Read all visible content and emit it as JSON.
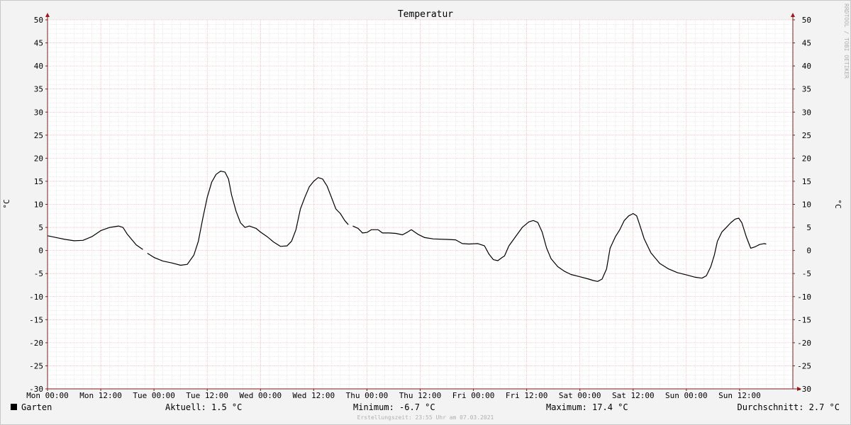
{
  "chart_data": {
    "type": "line",
    "title": "Temperatur",
    "ylabel": "°C",
    "ylabel_right": "°C",
    "watermark": "RRDTOOL / TOBI OETIKER",
    "ylim": [
      -30,
      50
    ],
    "yticks": [
      -30,
      -25,
      -20,
      -15,
      -10,
      -5,
      0,
      5,
      10,
      15,
      20,
      25,
      30,
      35,
      40,
      45,
      50
    ],
    "xlim": [
      0,
      168
    ],
    "x_unit": "hours since Mon 00:00",
    "xticks": [
      {
        "x": 0,
        "label": "Mon 00:00"
      },
      {
        "x": 12,
        "label": "Mon 12:00"
      },
      {
        "x": 24,
        "label": "Tue 00:00"
      },
      {
        "x": 36,
        "label": "Tue 12:00"
      },
      {
        "x": 48,
        "label": "Wed 00:00"
      },
      {
        "x": 60,
        "label": "Wed 12:00"
      },
      {
        "x": 72,
        "label": "Thu 00:00"
      },
      {
        "x": 84,
        "label": "Thu 12:00"
      },
      {
        "x": 96,
        "label": "Fri 00:00"
      },
      {
        "x": 108,
        "label": "Fri 12:00"
      },
      {
        "x": 120,
        "label": "Sat 00:00"
      },
      {
        "x": 132,
        "label": "Sat 12:00"
      },
      {
        "x": 144,
        "label": "Sun 00:00"
      },
      {
        "x": 156,
        "label": "Sun 12:00"
      }
    ],
    "grid": true,
    "series": [
      {
        "name": "Garten",
        "color": "#000000",
        "segments": [
          [
            [
              0,
              3.2
            ],
            [
              2,
              2.8
            ],
            [
              4,
              2.4
            ],
            [
              6,
              2.1
            ],
            [
              8,
              2.2
            ],
            [
              10,
              3.0
            ],
            [
              12,
              4.3
            ],
            [
              14,
              5.0
            ],
            [
              16,
              5.3
            ],
            [
              17,
              5.0
            ],
            [
              18,
              3.5
            ],
            [
              20,
              1.2
            ],
            [
              21.5,
              0.2
            ]
          ],
          [
            [
              22.5,
              -0.6
            ],
            [
              24,
              -1.5
            ],
            [
              26,
              -2.3
            ],
            [
              28,
              -2.7
            ],
            [
              30,
              -3.2
            ],
            [
              31.5,
              -3.0
            ],
            [
              33,
              -1.0
            ],
            [
              34,
              2.0
            ],
            [
              35,
              7.0
            ],
            [
              36,
              11.5
            ],
            [
              37,
              14.8
            ],
            [
              38,
              16.5
            ],
            [
              39,
              17.2
            ],
            [
              40,
              17.0
            ],
            [
              40.8,
              15.5
            ],
            [
              41.5,
              12.0
            ],
            [
              42.5,
              8.5
            ],
            [
              43.5,
              6.0
            ],
            [
              44.5,
              5.0
            ],
            [
              45.5,
              5.3
            ],
            [
              47,
              4.8
            ],
            [
              48,
              4.0
            ],
            [
              49.5,
              3.0
            ],
            [
              51,
              1.8
            ],
            [
              52.5,
              0.9
            ],
            [
              54,
              1.0
            ],
            [
              55,
              2.0
            ],
            [
              56,
              4.5
            ],
            [
              57,
              9.0
            ],
            [
              58,
              11.5
            ],
            [
              59,
              13.8
            ],
            [
              60,
              15.0
            ],
            [
              61,
              15.8
            ],
            [
              62,
              15.5
            ],
            [
              63,
              14.0
            ],
            [
              64,
              11.5
            ],
            [
              65,
              9.0
            ],
            [
              66,
              8.0
            ],
            [
              67,
              6.5
            ],
            [
              67.8,
              5.6
            ]
          ],
          [
            [
              68.8,
              5.3
            ],
            [
              70,
              4.8
            ],
            [
              71,
              3.8
            ],
            [
              72,
              3.9
            ],
            [
              73,
              4.5
            ],
            [
              74.5,
              4.5
            ],
            [
              75.5,
              3.8
            ],
            [
              77,
              3.8
            ],
            [
              78.5,
              3.7
            ],
            [
              80,
              3.4
            ],
            [
              81,
              3.9
            ],
            [
              82,
              4.5
            ],
            [
              83.5,
              3.5
            ],
            [
              85,
              2.8
            ],
            [
              87,
              2.5
            ],
            [
              90,
              2.4
            ],
            [
              92,
              2.3
            ],
            [
              93.5,
              1.5
            ],
            [
              95,
              1.4
            ],
            [
              97,
              1.5
            ],
            [
              98.5,
              1.0
            ],
            [
              99.5,
              -0.8
            ],
            [
              100.5,
              -2.0
            ],
            [
              101.5,
              -2.2
            ],
            [
              102.5,
              -1.5
            ],
            [
              103,
              -1.2
            ],
            [
              104,
              1.0
            ],
            [
              105.5,
              3.0
            ],
            [
              107,
              5.0
            ],
            [
              108.5,
              6.2
            ],
            [
              109.5,
              6.5
            ],
            [
              110.5,
              6.1
            ],
            [
              111.5,
              4.0
            ],
            [
              112.5,
              0.5
            ],
            [
              113.5,
              -1.8
            ],
            [
              115,
              -3.5
            ],
            [
              116.5,
              -4.5
            ],
            [
              118,
              -5.2
            ],
            [
              120,
              -5.7
            ],
            [
              122,
              -6.2
            ],
            [
              123,
              -6.5
            ],
            [
              124,
              -6.7
            ],
            [
              125,
              -6.2
            ],
            [
              126,
              -4.0
            ],
            [
              126.8,
              0.5
            ],
            [
              128,
              3.0
            ],
            [
              129,
              4.5
            ],
            [
              130,
              6.5
            ],
            [
              131,
              7.5
            ],
            [
              132,
              8.0
            ],
            [
              132.8,
              7.5
            ],
            [
              133.5,
              5.5
            ],
            [
              134.5,
              2.5
            ],
            [
              136,
              -0.5
            ],
            [
              138,
              -2.8
            ],
            [
              140,
              -4.0
            ],
            [
              142,
              -4.8
            ],
            [
              144,
              -5.3
            ],
            [
              146,
              -5.8
            ],
            [
              147.5,
              -6.0
            ],
            [
              148.5,
              -5.5
            ],
            [
              149.5,
              -3.5
            ],
            [
              150.3,
              -1.0
            ],
            [
              151,
              2.0
            ],
            [
              152,
              4.0
            ],
            [
              153,
              5.0
            ],
            [
              154,
              6.0
            ],
            [
              155,
              6.8
            ],
            [
              155.8,
              7.0
            ],
            [
              156.5,
              6.0
            ],
            [
              157.5,
              3.0
            ],
            [
              158.5,
              0.5
            ],
            [
              159.5,
              0.8
            ],
            [
              160.5,
              1.3
            ],
            [
              161.5,
              1.5
            ],
            [
              162,
              1.4
            ]
          ]
        ]
      }
    ]
  },
  "legend": {
    "series_name": "Garten",
    "series_color": "#000000",
    "aktuell": "Aktuell: 1.5 °C",
    "minimum": "Minimum: -6.7 °C",
    "maximum": "Maximum: 17.4 °C",
    "durchschnitt": "Durchschnitt: 2.7 °C",
    "timestamp": "Erstellungszeit: 23:55 Uhr am 07.03.2021"
  },
  "colors": {
    "background": "#f3f3f3",
    "plot_background": "#ffffff",
    "major_grid": "#e8a0a0",
    "minor_grid": "#d8d8d8",
    "axis": "#7a1f1f",
    "arrow": "#a01818",
    "text": "#000000",
    "watermark": "#b0b0b0"
  }
}
